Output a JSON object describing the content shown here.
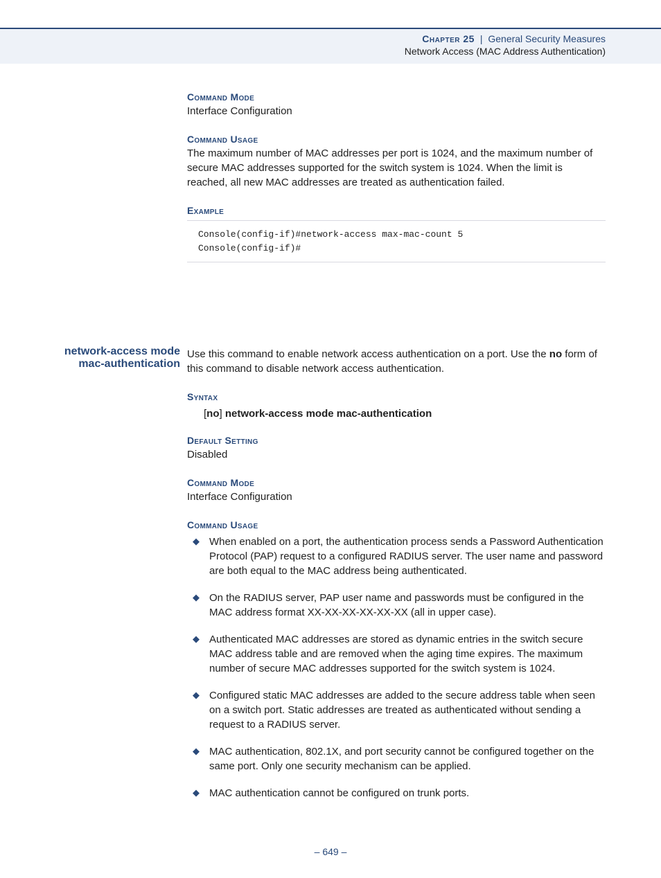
{
  "header": {
    "chapter_label": "Chapter 25",
    "chapter_title": "General Security Measures",
    "subtitle": "Network Access (MAC Address Authentication)"
  },
  "section1": {
    "cmd_mode_heading": "Command Mode",
    "cmd_mode_text": "Interface Configuration",
    "cmd_usage_heading": "Command Usage",
    "cmd_usage_text": "The maximum number of MAC addresses per port is 1024, and the maximum number of secure MAC addresses supported for the switch system is 1024. When the limit is reached, all new MAC addresses are treated as authentication failed.",
    "example_heading": "Example",
    "example_code": "Console(config-if)#network-access max-mac-count 5\nConsole(config-if)#"
  },
  "section2": {
    "sidebar_title": "network-access mode mac-authentication",
    "intro_part1": "Use this command to enable network access authentication on a port. Use the ",
    "intro_bold": "no",
    "intro_part2": " form of this command to disable network access authentication.",
    "syntax_heading": "Syntax",
    "syntax_text_prefix": "[",
    "syntax_text_bold1": "no",
    "syntax_text_mid": "] ",
    "syntax_text_bold2": "network-access mode mac-authentication",
    "default_heading": "Default Setting",
    "default_text": "Disabled",
    "cmd_mode_heading": "Command Mode",
    "cmd_mode_text": "Interface Configuration",
    "cmd_usage_heading": "Command Usage",
    "bullets": [
      "When enabled on a port, the authentication process sends a Password Authentication Protocol (PAP) request to a configured RADIUS server. The user name and password are both equal to the MAC address being authenticated.",
      "On the RADIUS server, PAP user name and passwords must be configured in the MAC address format XX-XX-XX-XX-XX-XX (all in upper case).",
      "Authenticated MAC addresses are stored as dynamic entries in the switch secure MAC address table and are removed when the aging time expires. The maximum number of secure MAC addresses supported for the switch system is 1024.",
      "Configured static MAC addresses are added to the secure address table when seen on a switch port. Static addresses are treated as authenticated without sending a request to a RADIUS server.",
      "MAC authentication, 802.1X, and port security cannot be configured together on the same port. Only one security mechanism can be applied.",
      "MAC authentication cannot be configured on trunk ports."
    ]
  },
  "page_number": "–  649  –"
}
